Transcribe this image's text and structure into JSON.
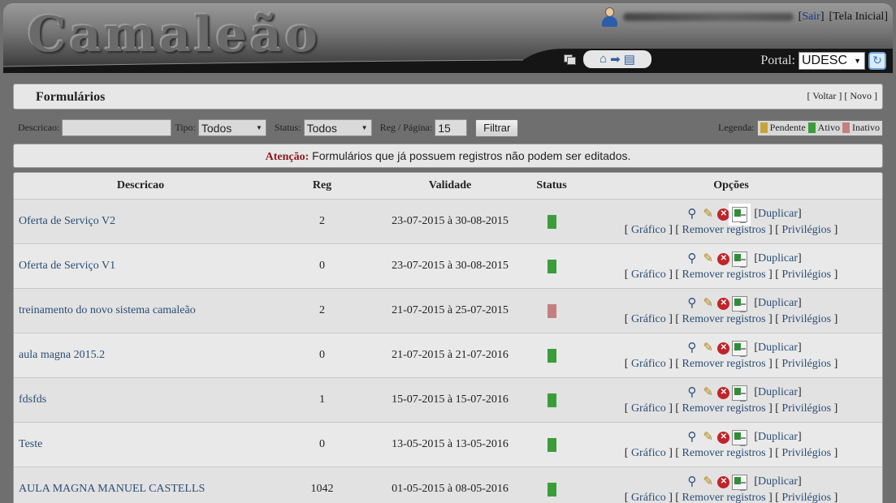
{
  "header": {
    "logo": "Camaleão",
    "sair": "Sair",
    "tela_inicial": "Tela Inicial",
    "portal_label": "Portal:",
    "portal_value": "UDESC"
  },
  "page": {
    "title": "Formulários",
    "voltar": "Voltar",
    "novo": "Novo"
  },
  "filters": {
    "descricao_label": "Descricao:",
    "descricao_value": "",
    "tipo_label": "Tipo:",
    "tipo_value": "Todos",
    "status_label": "Status:",
    "status_value": "Todos",
    "reg_label": "Reg / Página:",
    "reg_value": "15",
    "filtrar": "Filtrar"
  },
  "legend": {
    "label": "Legenda:",
    "items": [
      {
        "label": "Pendente",
        "color": "#c9a33a"
      },
      {
        "label": "Ativo",
        "color": "#3a9d3a"
      },
      {
        "label": "Inativo",
        "color": "#c47f7f"
      }
    ]
  },
  "notice": {
    "strong": "Atenção:",
    "text": " Formulários que já possuem registros não podem ser editados."
  },
  "table": {
    "headers": [
      "Descricao",
      "Reg",
      "Validade",
      "Status",
      "Opções"
    ],
    "option_labels": {
      "duplicar": "Duplicar",
      "grafico": "Gráfico",
      "remover": "Remover registros",
      "privilegios": "Privilégios"
    },
    "rows": [
      {
        "descricao": "Oferta de Serviço V2",
        "reg": "2",
        "validade": "23-07-2015 à 30-08-2015",
        "status_color": "#3a9d3a"
      },
      {
        "descricao": "Oferta de Serviço V1",
        "reg": "0",
        "validade": "23-07-2015 à 30-08-2015",
        "status_color": "#3a9d3a"
      },
      {
        "descricao": "treinamento do novo sistema camaleão",
        "reg": "2",
        "validade": "21-07-2015 à 25-07-2015",
        "status_color": "#c47f7f"
      },
      {
        "descricao": "aula magna 2015.2",
        "reg": "0",
        "validade": "21-07-2015 à 21-07-2016",
        "status_color": "#3a9d3a"
      },
      {
        "descricao": "fdsfds",
        "reg": "1",
        "validade": "15-07-2015 à 15-07-2016",
        "status_color": "#3a9d3a"
      },
      {
        "descricao": "Teste",
        "reg": "0",
        "validade": "13-05-2015 à 13-05-2016",
        "status_color": "#3a9d3a"
      },
      {
        "descricao": "AULA MAGNA MANUEL CASTELLS",
        "reg": "1042",
        "validade": "01-05-2015 à 08-05-2016",
        "status_color": "#3a9d3a"
      }
    ]
  }
}
